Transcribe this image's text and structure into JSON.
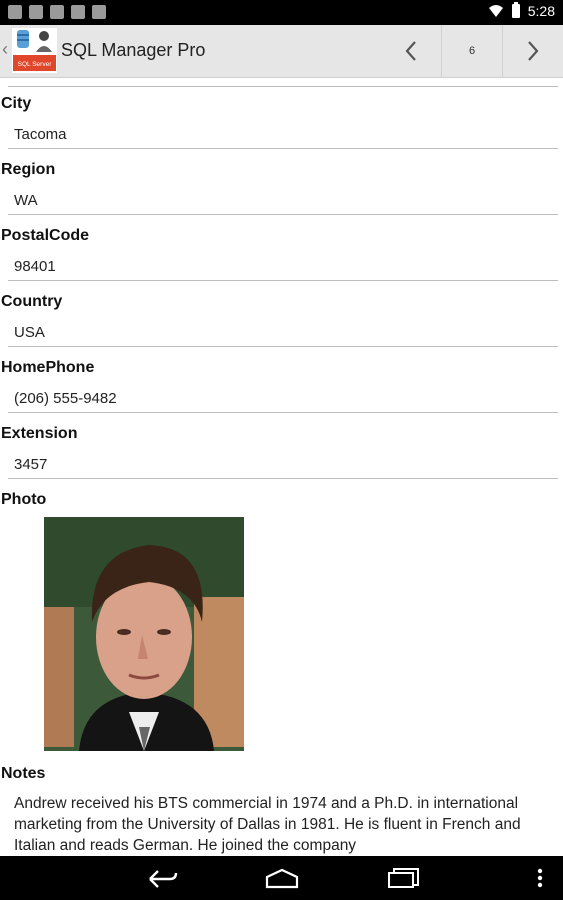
{
  "status_bar": {
    "time": "5:28"
  },
  "action_bar": {
    "title": "SQL Manager Pro",
    "record_number": "6"
  },
  "fields": [
    {
      "label": "City",
      "value": "Tacoma"
    },
    {
      "label": "Region",
      "value": "WA"
    },
    {
      "label": "PostalCode",
      "value": "98401"
    },
    {
      "label": "Country",
      "value": "USA"
    },
    {
      "label": "HomePhone",
      "value": "(206) 555-9482"
    },
    {
      "label": "Extension",
      "value": "3457"
    }
  ],
  "photo": {
    "label": "Photo"
  },
  "notes": {
    "label": "Notes",
    "text": "Andrew received his BTS commercial in 1974 and a Ph.D. in international marketing from the University of Dallas in 1981.  He is fluent in French and Italian and reads German.  He joined the company"
  },
  "colors": {
    "action_bar": "#e6e6e6",
    "status_bar": "#000000",
    "nav_bar": "#000000"
  }
}
